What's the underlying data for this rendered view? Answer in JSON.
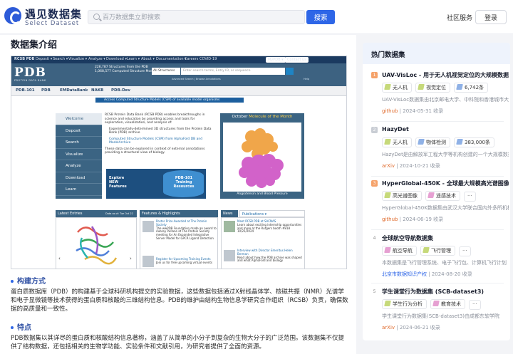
{
  "header": {
    "logo_cn": "遇见数据集",
    "logo_en": "Select Dataset",
    "search_placeholder": "百万数据集立即搜索",
    "search_button": "搜索",
    "community": "社区服务",
    "login": "登录"
  },
  "main": {
    "section_title": "数据集介绍",
    "structure_title": "构建方式",
    "structure_text": "蛋白质数据库（PDB）的构建基于全球科研机构提交的实验数据，这些数据包括通过X射线晶体学、核磁共振（NMR）光谱学和电子显微镜等技术获得的蛋白质和核酸的三维结构信息。PDB的维护由结构生物信息学研究合作组织（RCSB）负责，确保数据的高质量和一致性。",
    "features_title": "特点",
    "features_text": "PDB数据集以其详尽的蛋白质和核酸结构信息著称，涵盖了从简单的小分子到复杂的生物大分子的广泛范围。该数据集不仅提供了结构数据，还包括相关的生物学功能、实验条件和文献引用，为研究者提供了全面的资源。"
  },
  "screenshot": {
    "topbar": [
      "RCSB PDB",
      "Deposit ▾",
      "Search ▾",
      "Visualize ▾",
      "Analyze ▾",
      "Download ▾",
      "Learn ▾",
      "About ▾",
      "Documentation ▾",
      "Careers",
      "COVID-19"
    ],
    "topbar_right": [
      "MyPDB ▾",
      "Contact us"
    ],
    "logo": "PDB",
    "logo_sub": "PROTEIN DATA BANK",
    "stats": [
      "226,787 Structures from the PDB",
      "1,068,577 Computed Structure Models (CSM)"
    ],
    "search_select": "All Structures",
    "search_placeholder": "Enter search terms, Entry ID, or sequence",
    "adv_link": "Advanced Search | Browse Annotations",
    "help_link": "Help",
    "partners": [
      "PDB-101",
      "PDB",
      "EMDataBank",
      "NAKB",
      "PDB-Dev"
    ],
    "csm_bar": "Access Computed Structure Models (CSM) of available model organisms",
    "sidebar": [
      "Welcome",
      "Deposit",
      "Search",
      "Visualize",
      "Analyze",
      "Download",
      "Learn"
    ],
    "intro": "RCSB Protein Data Bank (RCSB PDB) enables breakthroughs in science and education by providing access and tools for exploration, visualization, and analysis of:",
    "intro_item1": "Experimentally-determined 3D structures from the Protein Data Bank (PDB) archive",
    "intro_item2": "Computed Structure Models (CSM) from AlphaFold DB and ModelArchive",
    "intro_tail": "These data can be explored in context of external annotations providing a structural view of biology.",
    "explore": "Explore NEW Features",
    "pdb101": "PDB-101 Training Resources",
    "mom_title_a": "October ",
    "mom_title_b": "Molecule of the Month",
    "mom_caption": "Angiotensin and Blood Pressure",
    "panel_latest": "Latest Entries",
    "panel_latest_sub": "Data as of: Tue Oct 22 2024",
    "panel_features": "Features & Highlights",
    "panel_news": "News",
    "panel_pubs": "Publications ▾",
    "features": [
      {
        "title": "Poster Prize Awarded at The Protein Society",
        "text": "The wwPDB Foundation made an award to Aubrey Pullano at The Protein Society meeting for An Expanded Integrative Server Model for GPCR Ligand Detection"
      },
      {
        "title": "Register for Upcoming Training Events",
        "text": "Join us for free upcoming virtual events"
      }
    ],
    "news": [
      {
        "title": "Meet RCSB PDB at SACNAS",
        "text": "Learn about exciting internship opportunities and more at the Rutgers booth #818",
        "date": "10/21/2024"
      },
      {
        "title": "Interview with Director Emeritus Helen Berman",
        "text": "Read about how the PDB archive was shaped and what AlphaFold and biology"
      }
    ]
  },
  "sidebar": {
    "title": "热门数据集",
    "items": [
      {
        "rank": "1",
        "title": "UAV-VisLoc - 用于无人机视觉定位的大规模数据集",
        "tags": [
          "无人机",
          "视觉定位",
          "6,742条"
        ],
        "desc": "UAV-VisLoc数据集由北京邮电大学、中科院和香港城市大学联合构建",
        "source": "github",
        "date": "2024-05-31 收录"
      },
      {
        "rank": "2",
        "title": "HazyDet",
        "tags": [
          "无人机",
          "物体检测",
          "383,000条"
        ],
        "desc": "HazyDet是由解放军工程大学等机构创建的一个大规模数据集",
        "source": "arXiv",
        "date": "2024-10-21 收录"
      },
      {
        "rank": "3",
        "title": "HyperGlobal-450K - 全球最大规模高光谱图像数据集",
        "tags": [
          "高光谱图像",
          "遥感技术"
        ],
        "desc": "HyperGlobal-450K数据集由武汉大学联合国内外多所机构",
        "source": "github",
        "date": "2024-06-19 收录"
      },
      {
        "rank": "4",
        "title": "全球航空导航数据集",
        "tags": [
          "航空导航",
          "飞行管理"
        ],
        "desc": "本数据集是飞行管理系统、电子飞行包、计算机飞行计划",
        "source": "北京市数据知识产权",
        "date": "2024-08-20 收录"
      },
      {
        "rank": "5",
        "title": "学生课堂行为数据集 (SCB-dataset3)",
        "tags": [
          "学生行为分析",
          "教育技术"
        ],
        "desc": "学生课堂行为数据集(SCB-dataset3)由成都东软学院",
        "source": "arXiv",
        "date": "2024-06-21 收录"
      }
    ],
    "more": "···"
  },
  "colors": {
    "accent": "#2e66e7",
    "rank_top": "#f5a26a",
    "rank_other": "#c9cdd4",
    "tag_icon": "#c6d97a"
  }
}
